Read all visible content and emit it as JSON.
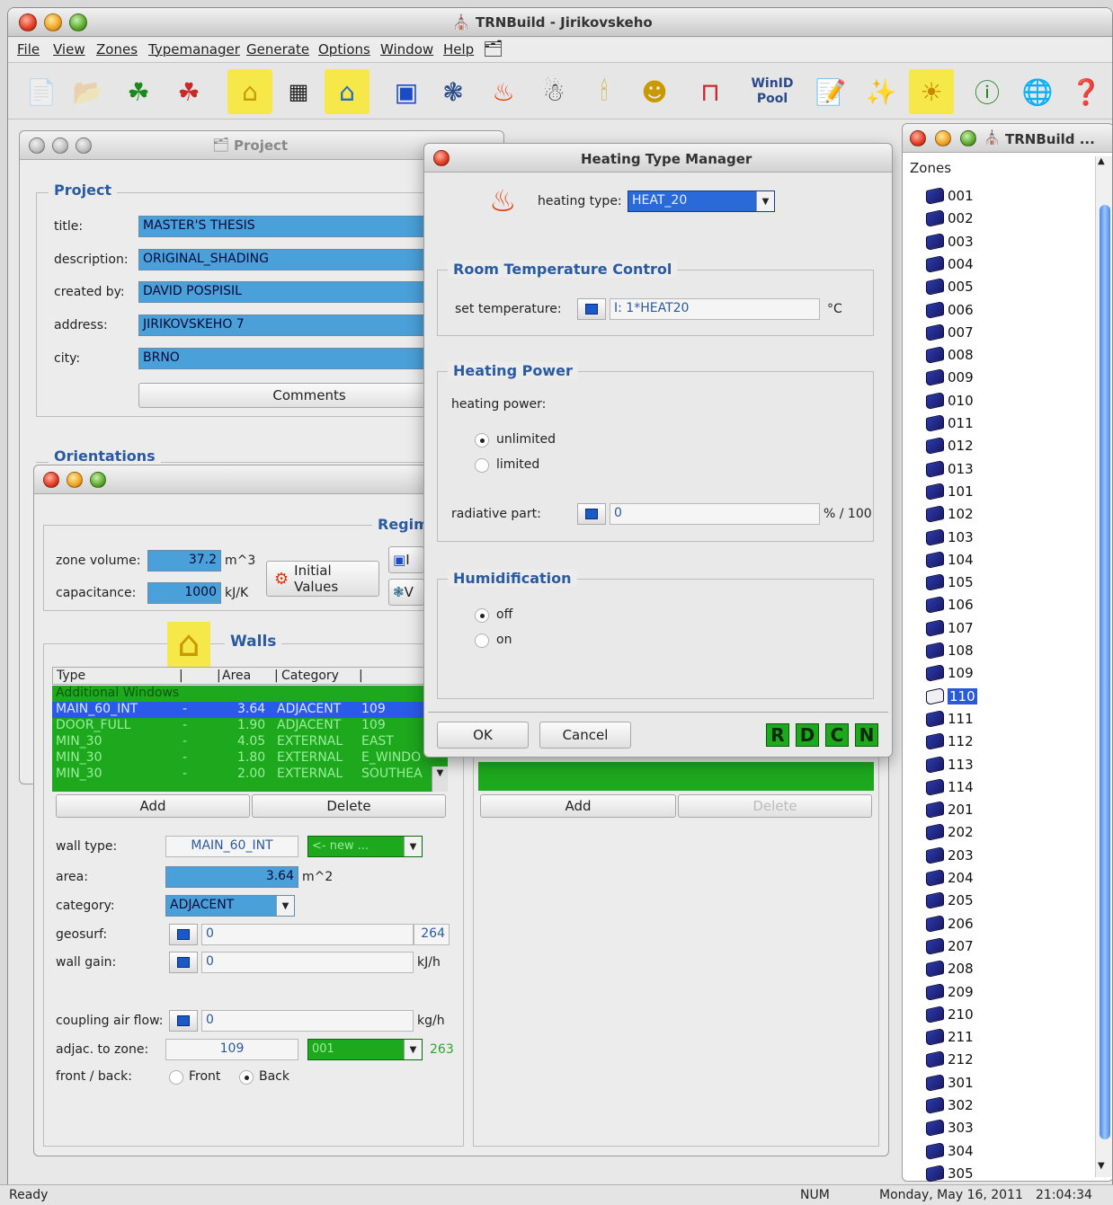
{
  "app": {
    "title": "TRNBuild - Jirikovskeho"
  },
  "menu": [
    "File",
    "View",
    "Zones",
    "Typemanager",
    "Generate",
    "Options",
    "Window",
    "Help"
  ],
  "toolbar": {
    "winid_line1": "WinID",
    "winid_line2": "Pool"
  },
  "project_window": {
    "title": "Project",
    "group_title": "Project",
    "labels": {
      "title": "title:",
      "description": "description:",
      "created_by": "created by:",
      "address": "address:",
      "city": "city:"
    },
    "values": {
      "title": "MASTER'S THESIS",
      "description": "ORIGINAL_SHADING",
      "created_by": "DAVID POSPISIL",
      "address": "JIRIKOVSKEHO 7",
      "city": "BRNO"
    },
    "comments_button": "Comments",
    "orientations_title": "Orientations"
  },
  "zone_window": {
    "regime_title": "Regim",
    "zone_volume_label": "zone volume:",
    "zone_volume": "37.2",
    "zone_volume_unit": "m^3",
    "capacitance_label": "capacitance:",
    "capacitance": "1000",
    "capacitance_unit": "kJ/K",
    "initial_values_button": "Initial Values",
    "side_btn1": "I",
    "side_btn2": "V",
    "walls_title": "Walls",
    "table_headers": [
      "Type",
      "Area",
      "Category"
    ],
    "table_section": "Additional Windows",
    "table_rows": [
      {
        "type": "MAIN_60_INT",
        "dash": "-",
        "area": "3.64",
        "category": "ADJACENT",
        "extra": "109"
      },
      {
        "type": "DOOR_FULL",
        "dash": "-",
        "area": "1.90",
        "category": "ADJACENT",
        "extra": "109"
      },
      {
        "type": "MIN_30",
        "dash": "-",
        "area": "4.05",
        "category": "EXTERNAL",
        "extra": "EAST"
      },
      {
        "type": "MIN_30",
        "dash": "-",
        "area": "1.80",
        "category": "EXTERNAL",
        "extra": "E_WINDO"
      },
      {
        "type": "MIN_30",
        "dash": "-",
        "area": "2.00",
        "category": "EXTERNAL",
        "extra": "SOUTHEA"
      }
    ],
    "add_button": "Add",
    "delete_button": "Delete",
    "add_button_right": "Add",
    "delete_button_right": "Delete",
    "wall_type_label": "wall type:",
    "wall_type": "MAIN_60_INT",
    "wall_type_select": "<- new ...",
    "area_label": "area:",
    "area": "3.64",
    "area_unit": "m^2",
    "category_label": "category:",
    "category": "ADJACENT",
    "geosurf_label": "geosurf:",
    "geosurf": "0",
    "geosurf_extra": "264",
    "wall_gain_label": "wall gain:",
    "wall_gain": "0",
    "wall_gain_unit": "kJ/h",
    "coupling_label": "coupling air flow:",
    "coupling": "0",
    "coupling_unit": "kg/h",
    "adjac_label": "adjac. to zone:",
    "adjac": "109",
    "adjac_select": "001",
    "adjac_extra": "263",
    "front_back_label": "front / back:",
    "front": "Front",
    "back": "Back"
  },
  "heating_dialog": {
    "title": "Heating Type Manager",
    "heating_type_label": "heating type:",
    "heating_type": "HEAT_20",
    "room_temp_title": "Room Temperature Control",
    "set_temp_label": "set temperature:",
    "set_temp": "I: 1*HEAT20",
    "set_temp_unit": "°C",
    "heating_power_title": "Heating Power",
    "heating_power_label": "heating power:",
    "unlimited": "unlimited",
    "limited": "limited",
    "radiative_label": "radiative part:",
    "radiative": "0",
    "radiative_unit": "% / 100",
    "humid_title": "Humidification",
    "off": "off",
    "on": "on",
    "ok": "OK",
    "cancel": "Cancel",
    "r": "R",
    "d": "D",
    "c": "C",
    "n": "N"
  },
  "zones_window": {
    "title": "TRNBuild ...",
    "header": "Zones",
    "selected": "110",
    "zones": [
      "001",
      "002",
      "003",
      "004",
      "005",
      "006",
      "007",
      "008",
      "009",
      "010",
      "011",
      "012",
      "013",
      "101",
      "102",
      "103",
      "104",
      "105",
      "106",
      "107",
      "108",
      "109",
      "110",
      "111",
      "112",
      "113",
      "114",
      "201",
      "202",
      "203",
      "204",
      "205",
      "206",
      "207",
      "208",
      "209",
      "210",
      "211",
      "212",
      "301",
      "302",
      "303",
      "304",
      "305"
    ]
  },
  "status": {
    "ready": "Ready",
    "num": "NUM",
    "date": "Monday, May 16, 2011",
    "time": "21:04:34"
  }
}
